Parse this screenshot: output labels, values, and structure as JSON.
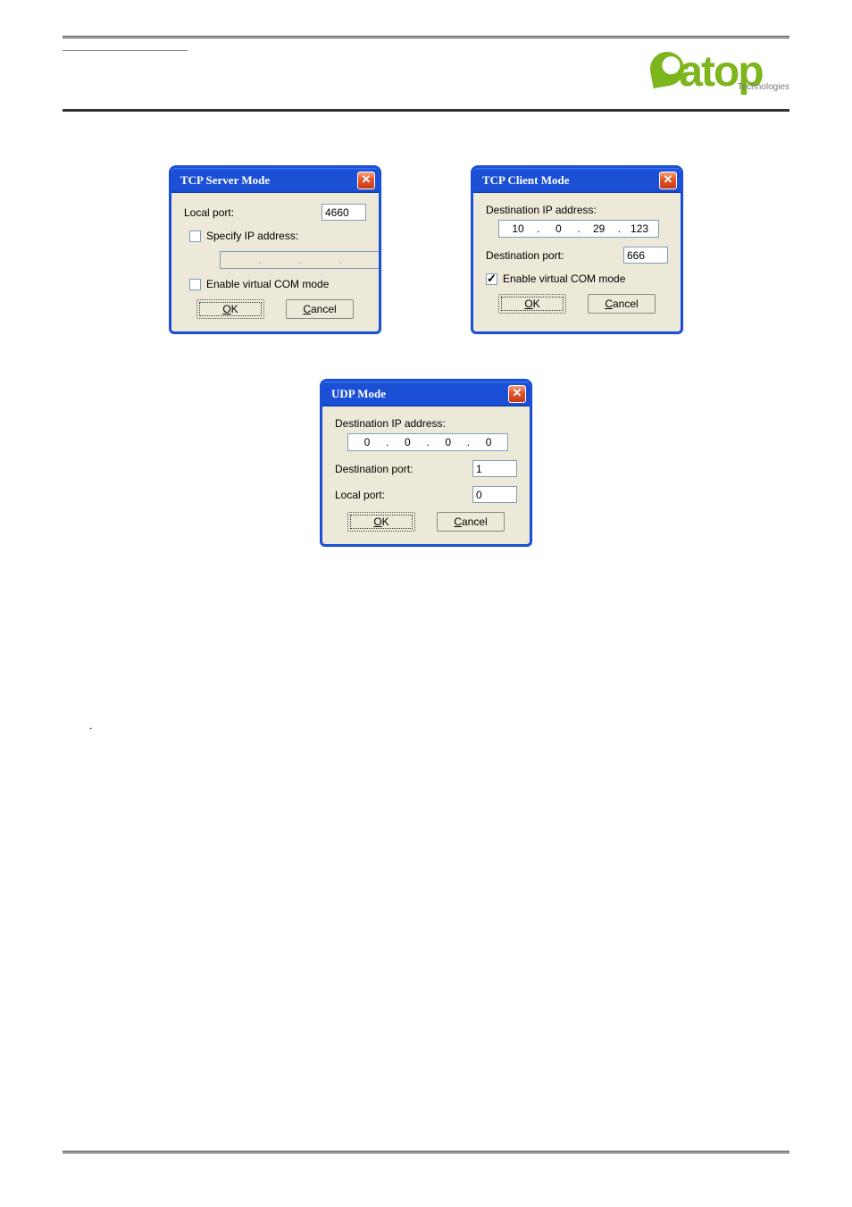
{
  "logo": {
    "text": "atop",
    "sub": "Technologies"
  },
  "dialogs": {
    "tcp_server": {
      "title": "TCP Server Mode",
      "local_port_label": "Local port:",
      "local_port_value": "4660",
      "specify_ip_label": "Specify IP address:",
      "specify_ip_checked": false,
      "ip": [
        "",
        "",
        "",
        ""
      ],
      "vcom_label": "Enable virtual COM mode",
      "vcom_checked": false,
      "ok": "OK",
      "cancel": "Cancel"
    },
    "tcp_client": {
      "title": "TCP Client Mode",
      "dest_ip_label": "Destination IP address:",
      "ip": [
        "10",
        "0",
        "29",
        "123"
      ],
      "dest_port_label": "Destination port:",
      "dest_port_value": "666",
      "vcom_label": "Enable virtual COM mode",
      "vcom_checked": true,
      "ok": "OK",
      "cancel": "Cancel"
    },
    "udp": {
      "title": "UDP Mode",
      "dest_ip_label": "Destination IP address:",
      "ip": [
        "0",
        "0",
        "0",
        "0"
      ],
      "dest_port_label": "Destination port:",
      "dest_port_value": "1",
      "local_port_label": "Local port:",
      "local_port_value": "0",
      "ok": "OK",
      "cancel": "Cancel"
    }
  },
  "stray": "."
}
